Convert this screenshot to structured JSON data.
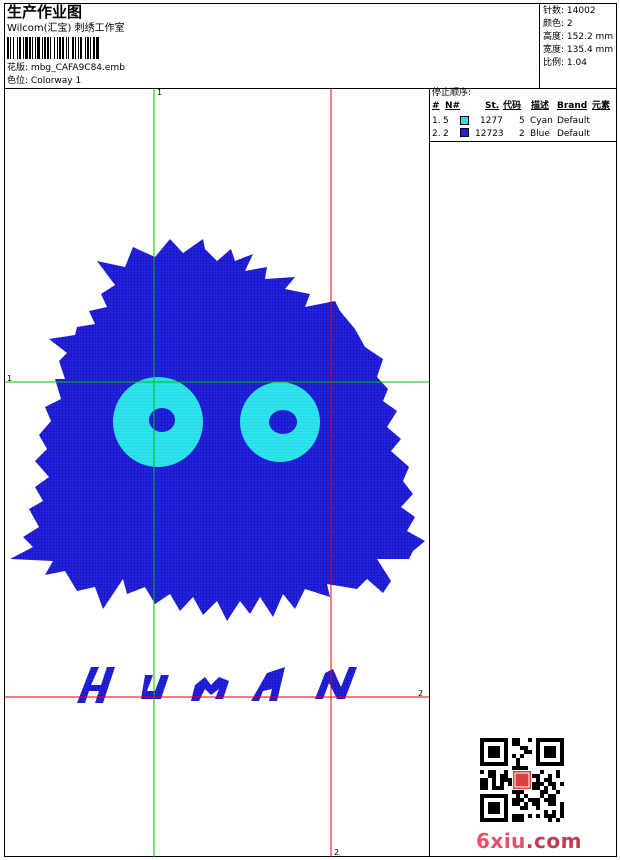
{
  "header": {
    "title": "生产作业图",
    "company": "Wilcom(汇宝) 刺绣工作室",
    "design_file_label": "花版:",
    "design_file": "mbg_CAFA9C84.emb",
    "colorway_label": "色位:",
    "colorway": "Colorway 1"
  },
  "stats": {
    "stitches_label": "针数:",
    "stitches": "14002",
    "colors_label": "颜色:",
    "colors": "2",
    "height_label": "高度:",
    "height": "152.2 mm",
    "width_label": "宽度:",
    "width": "135.4 mm",
    "scale_label": "比例:",
    "scale": "1.04"
  },
  "stop_sequence": {
    "title": "停止顺序:",
    "columns": [
      "#",
      "N#",
      "St.",
      "代码",
      "描述",
      "Brand",
      "元素"
    ],
    "rows": [
      {
        "index": "1.",
        "needle": "5",
        "color": "#29e0e8",
        "stitches": "1277",
        "code": "5",
        "description": "Cyan",
        "brand": "Default"
      },
      {
        "index": "2.",
        "needle": "2",
        "color": "#1f1fd8",
        "stitches": "12723",
        "code": "2",
        "description": "Blue",
        "brand": "Default"
      }
    ]
  },
  "guides": {
    "green_v_label": "1",
    "green_h_label": "1",
    "red_h_label": "2",
    "red_v_label": "2"
  },
  "design": {
    "text": "HUMAN",
    "body_color": "#1f1fd8",
    "eye_color": "#29e0e8"
  },
  "footer": {
    "site": "6xiu",
    "site_tld": ".com"
  }
}
